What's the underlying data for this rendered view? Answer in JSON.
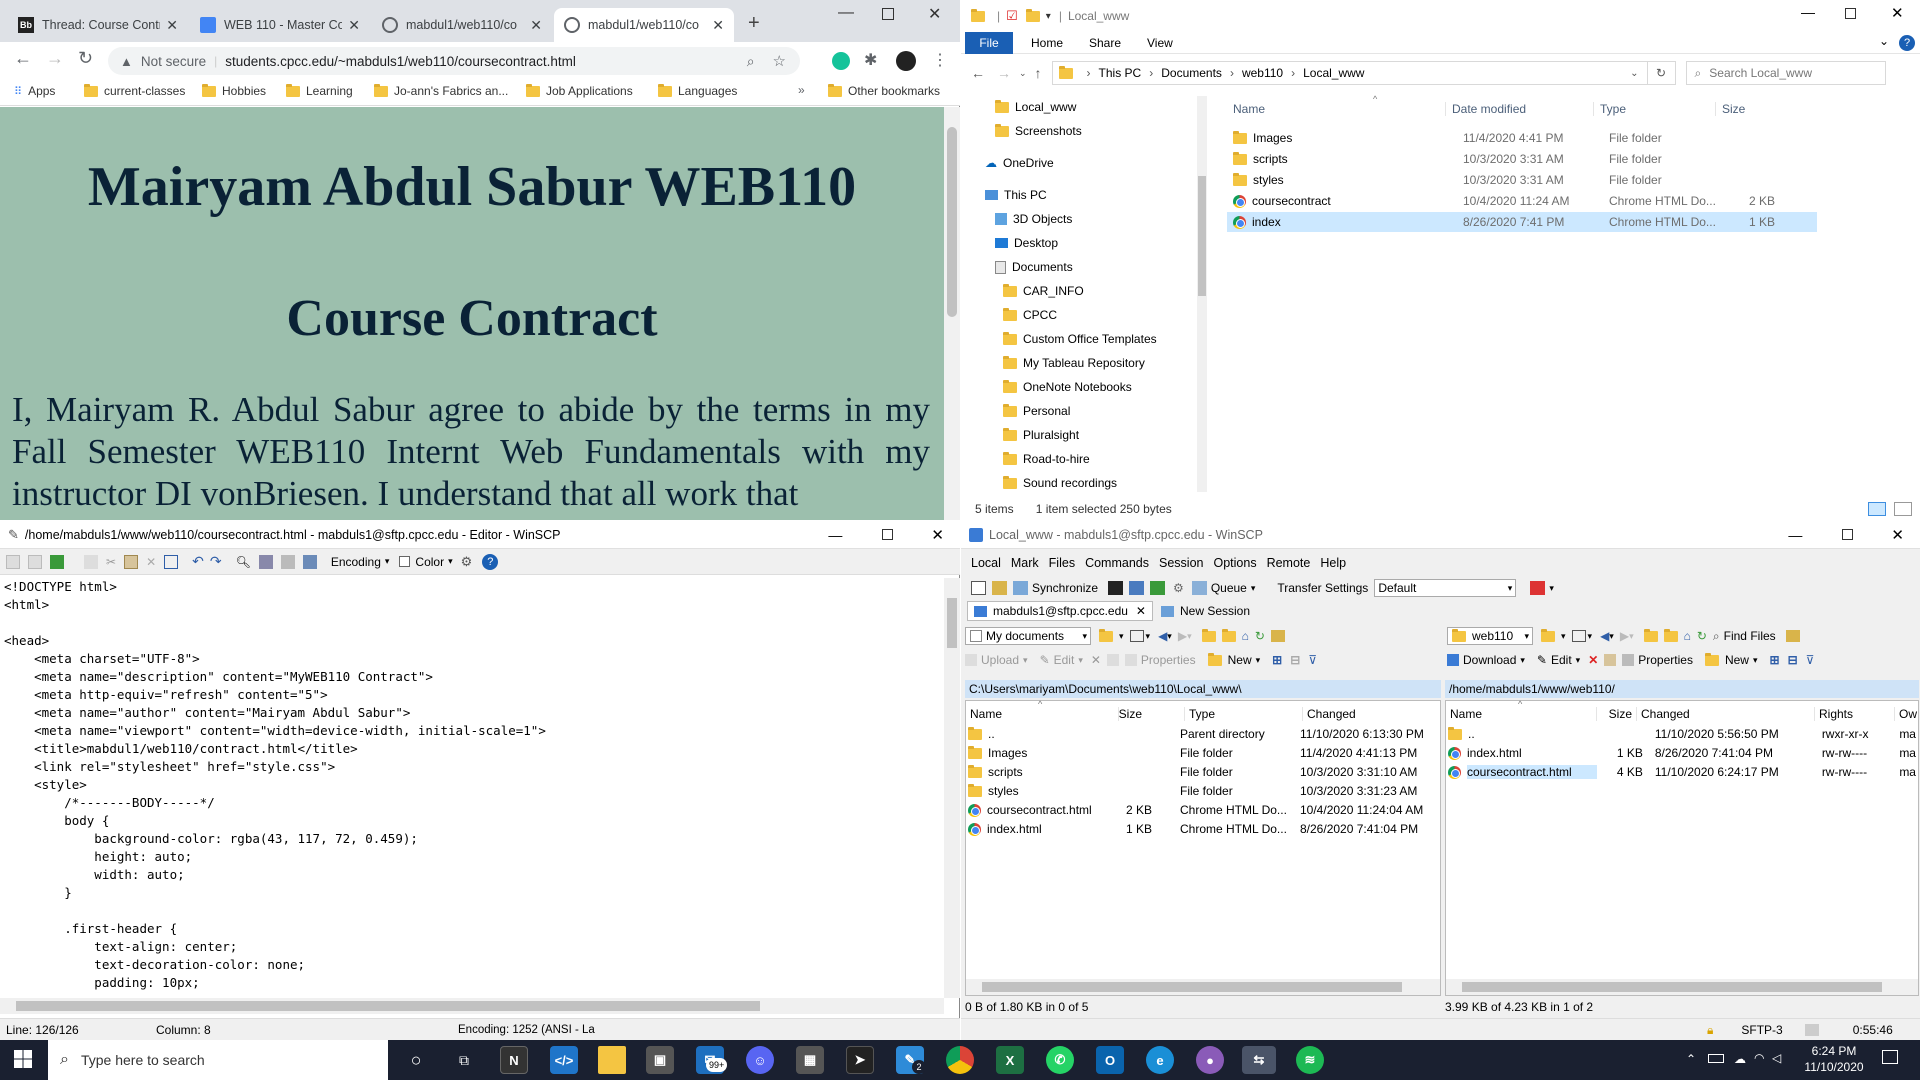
{
  "chrome": {
    "tabs": [
      {
        "label": "Thread: Course Contra",
        "fav": "Bb"
      },
      {
        "label": "WEB 110 - Master Co",
        "fav": "doc-icon"
      },
      {
        "label": "mabdul1/web110/co",
        "fav": "globe-icon"
      },
      {
        "label": "mabdul1/web110/co",
        "fav": "globe-icon"
      }
    ],
    "security": "Not secure",
    "url": "students.cpcc.edu/~mabduls1/web110/coursecontract.html",
    "bookmarks": [
      "Apps",
      "current-classes",
      "Hobbies",
      "Learning",
      "Jo-ann's Fabrics an...",
      "Job Applications",
      "Languages",
      "Other bookmarks"
    ],
    "page": {
      "h1": "Mairyam Abdul Sabur WEB110",
      "h2": "Course Contract",
      "para": "I, Mairyam R. Abdul Sabur agree to abide by the terms in my Fall Semester WEB110 Internt Web Fundamentals with my instructor DI vonBriesen. I understand that all work that"
    }
  },
  "explorer": {
    "title": "Local_www",
    "ribbon": [
      "File",
      "Home",
      "Share",
      "View"
    ],
    "breadcrumb": [
      "This PC",
      "Documents",
      "web110",
      "Local_www"
    ],
    "search_placeholder": "Search Local_www",
    "nav": [
      "Local_www",
      "Screenshots",
      "OneDrive",
      "This PC",
      "3D Objects",
      "Desktop",
      "Documents",
      "CAR_INFO",
      "CPCC",
      "Custom Office Templates",
      "My Tableau Repository",
      "OneNote Notebooks",
      "Personal",
      "Pluralsight",
      "Road-to-hire",
      "Sound recordings"
    ],
    "columns": [
      "Name",
      "Date modified",
      "Type",
      "Size"
    ],
    "files": [
      {
        "name": "Images",
        "date": "11/4/2020 4:41 PM",
        "type": "File folder",
        "size": ""
      },
      {
        "name": "scripts",
        "date": "10/3/2020 3:31 AM",
        "type": "File folder",
        "size": ""
      },
      {
        "name": "styles",
        "date": "10/3/2020 3:31 AM",
        "type": "File folder",
        "size": ""
      },
      {
        "name": "coursecontract",
        "date": "10/4/2020 11:24 AM",
        "type": "Chrome HTML Do...",
        "size": "2 KB"
      },
      {
        "name": "index",
        "date": "8/26/2020 7:41 PM",
        "type": "Chrome HTML Do...",
        "size": "1 KB"
      }
    ],
    "status": {
      "items": "5 items",
      "selected": "1 item selected  250 bytes"
    }
  },
  "editor": {
    "title": "/home/mabduls1/www/web110/coursecontract.html - mabduls1@sftp.cpcc.edu - Editor - WinSCP",
    "encoding_label": "Encoding",
    "color_label": "Color",
    "code": "<!DOCTYPE html>\n<html>\n\n<head>\n    <meta charset=\"UTF-8\">\n    <meta name=\"description\" content=\"MyWEB110 Contract\">\n    <meta http-equiv=\"refresh\" content=\"5\">\n    <meta name=\"author\" content=\"Mairyam Abdul Sabur\">\n    <meta name=\"viewport\" content=\"width=device-width, initial-scale=1\">\n    <title>mabdul1/web110/contract.html</title>\n    <link rel=\"stylesheet\" href=\"style.css\">\n    <style>\n        /*-------BODY-----*/\n        body {\n            background-color: rgba(43, 117, 72, 0.459);\n            height: auto;\n            width: auto;\n        }\n\n        .first-header {\n            text-align: center;\n            text-decoration-color: none;\n            padding: 10px;",
    "status": {
      "line": "Line: 126/126",
      "column": "Column: 8",
      "encoding": "Encoding: 1252  (ANSI - La"
    }
  },
  "winscp": {
    "title": "Local_www - mabduls1@sftp.cpcc.edu - WinSCP",
    "menu": [
      "Local",
      "Mark",
      "Files",
      "Commands",
      "Session",
      "Options",
      "Remote",
      "Help"
    ],
    "toolbar": {
      "sync": "Synchronize",
      "queue": "Queue",
      "transfer_label": "Transfer Settings",
      "transfer_value": "Default"
    },
    "session_tab": "mabduls1@sftp.cpcc.edu",
    "new_session": "New Session",
    "left": {
      "location": "My documents",
      "path": "C:\\Users\\mariyam\\Documents\\web110\\Local_www\\",
      "actions": [
        "Upload",
        "Edit",
        "Properties",
        "New"
      ],
      "columns": [
        "Name",
        "Size",
        "Type",
        "Changed"
      ],
      "rows": [
        {
          "name": "..",
          "size": "",
          "type": "Parent directory",
          "changed": "11/10/2020 6:13:30 PM"
        },
        {
          "name": "Images",
          "size": "",
          "type": "File folder",
          "changed": "11/4/2020 4:41:13 PM"
        },
        {
          "name": "scripts",
          "size": "",
          "type": "File folder",
          "changed": "10/3/2020 3:31:10 AM"
        },
        {
          "name": "styles",
          "size": "",
          "type": "File folder",
          "changed": "10/3/2020 3:31:23 AM"
        },
        {
          "name": "coursecontract.html",
          "size": "2 KB",
          "type": "Chrome HTML Do...",
          "changed": "10/4/2020 11:24:04 AM"
        },
        {
          "name": "index.html",
          "size": "1 KB",
          "type": "Chrome HTML Do...",
          "changed": "8/26/2020 7:41:04 PM"
        }
      ],
      "status": "0 B of 1.80 KB in 0 of 5"
    },
    "right": {
      "location": "web110",
      "path": "/home/mabduls1/www/web110/",
      "actions": [
        "Download",
        "Edit",
        "Properties",
        "New"
      ],
      "find": "Find Files",
      "columns": [
        "Name",
        "Size",
        "Changed",
        "Rights",
        "Ow"
      ],
      "rows": [
        {
          "name": "..",
          "size": "",
          "changed": "11/10/2020 5:56:50 PM",
          "rights": "rwxr-xr-x",
          "owner": "ma"
        },
        {
          "name": "index.html",
          "size": "1 KB",
          "changed": "8/26/2020 7:41:04 PM",
          "rights": "rw-rw----",
          "owner": "ma"
        },
        {
          "name": "coursecontract.html",
          "size": "4 KB",
          "changed": "11/10/2020 6:24:17 PM",
          "rights": "rw-rw----",
          "owner": "ma"
        }
      ],
      "status": "3.99 KB of 4.23 KB in 1 of 2"
    },
    "status": {
      "protocol": "SFTP-3",
      "time": "0:55:46"
    }
  },
  "taskbar": {
    "search_placeholder": "Type here to search",
    "time": "6:24 PM",
    "date": "11/10/2020",
    "mail_badge": "99+",
    "teams_badge": "2"
  },
  "colors": {
    "page_bg": "#9cbfad",
    "heading": "#0a2236",
    "taskbar": "#1a2030",
    "selection": "#cce8ff"
  }
}
